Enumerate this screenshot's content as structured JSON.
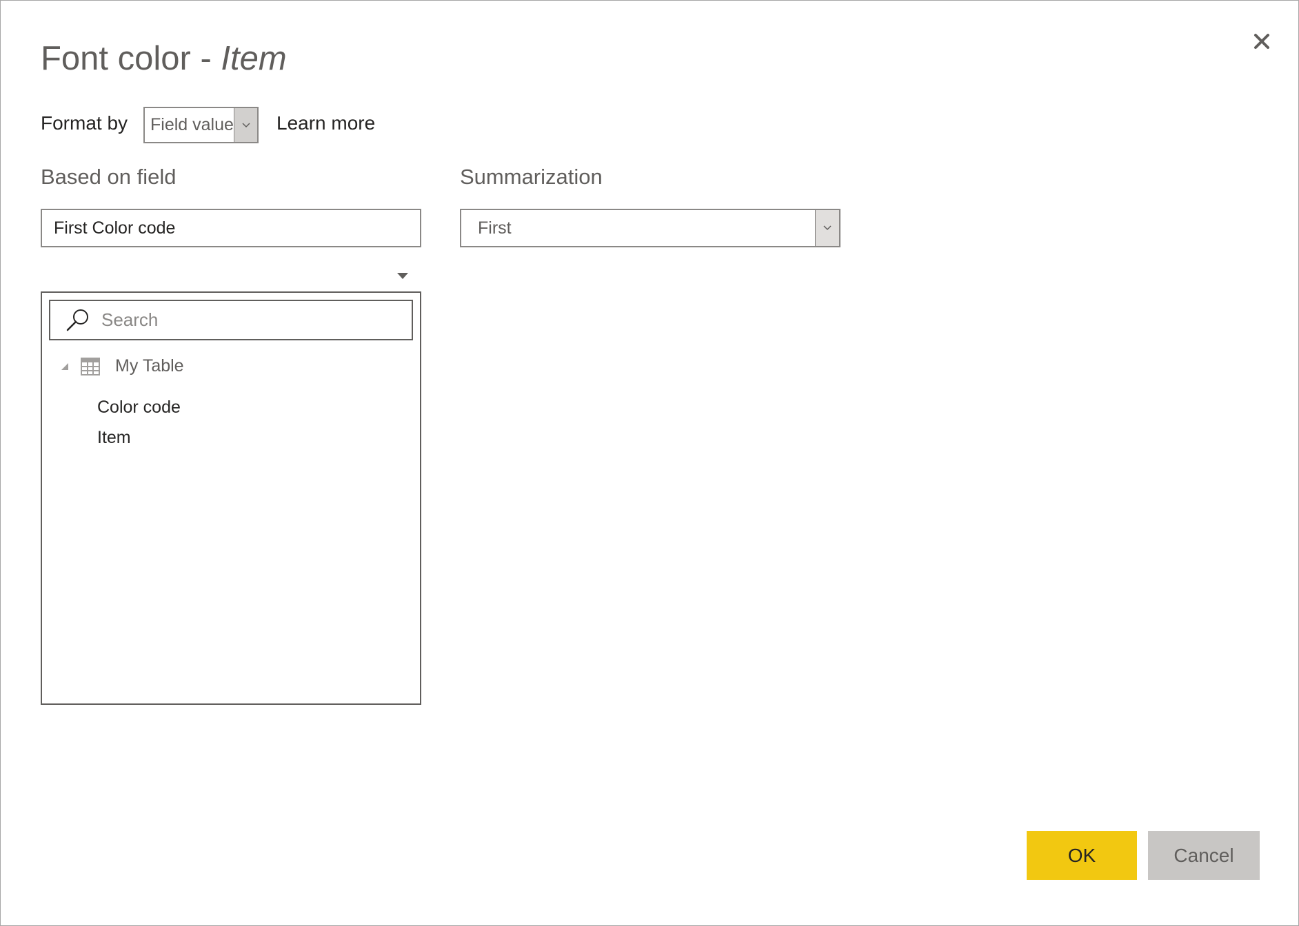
{
  "dialog": {
    "title_prefix": "Font color - ",
    "title_field": "Item"
  },
  "format_by": {
    "label": "Format by",
    "selected": "Field value",
    "learn_more": "Learn more"
  },
  "based_on_field": {
    "label": "Based on field",
    "value": "First Color code"
  },
  "summarization": {
    "label": "Summarization",
    "selected": "First"
  },
  "field_list": {
    "search_placeholder": "Search",
    "table": {
      "name": "My Table",
      "expanded": true,
      "fields": [
        "Color code",
        "Item"
      ]
    }
  },
  "buttons": {
    "ok": "OK",
    "cancel": "Cancel"
  },
  "colors": {
    "primary_button": "#f2c811",
    "secondary_button": "#c8c6c4"
  }
}
